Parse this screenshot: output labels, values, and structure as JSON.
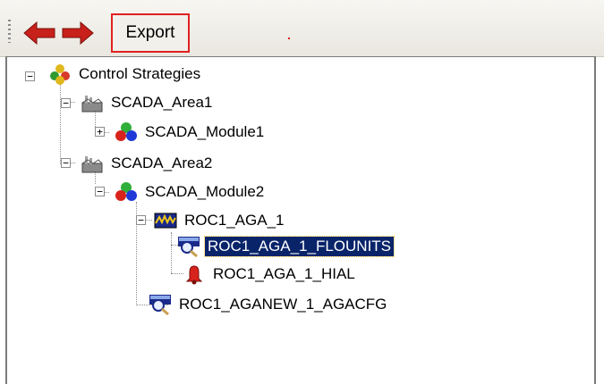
{
  "toolbar": {
    "back_icon": "back-arrow-icon",
    "forward_icon": "forward-arrow-icon",
    "export_label": "Export",
    "accent_color": "#e02020",
    "arrow_color": "#c8201a"
  },
  "tree": {
    "nodes": [
      {
        "label": "Control Strategies",
        "icon": "control-strategies-icon",
        "expanded": true
      },
      {
        "label": "SCADA_Area1",
        "icon": "area-icon",
        "expanded": true
      },
      {
        "label": "SCADA_Module1",
        "icon": "module-icon",
        "expanded": false
      },
      {
        "label": "SCADA_Area2",
        "icon": "area-icon",
        "expanded": true
      },
      {
        "label": "SCADA_Module2",
        "icon": "module-icon",
        "expanded": true
      },
      {
        "label": "ROC1_AGA_1",
        "icon": "function-block-icon",
        "expanded": true
      },
      {
        "label": "ROC1_AGA_1_FLOUNITS",
        "icon": "parameter-icon",
        "selected": true
      },
      {
        "label": "ROC1_AGA_1_HIAL",
        "icon": "alarm-icon"
      },
      {
        "label": "ROC1_AGANEW_1_AGACFG",
        "icon": "parameter-icon"
      }
    ],
    "selection_color": "#0a246a"
  }
}
